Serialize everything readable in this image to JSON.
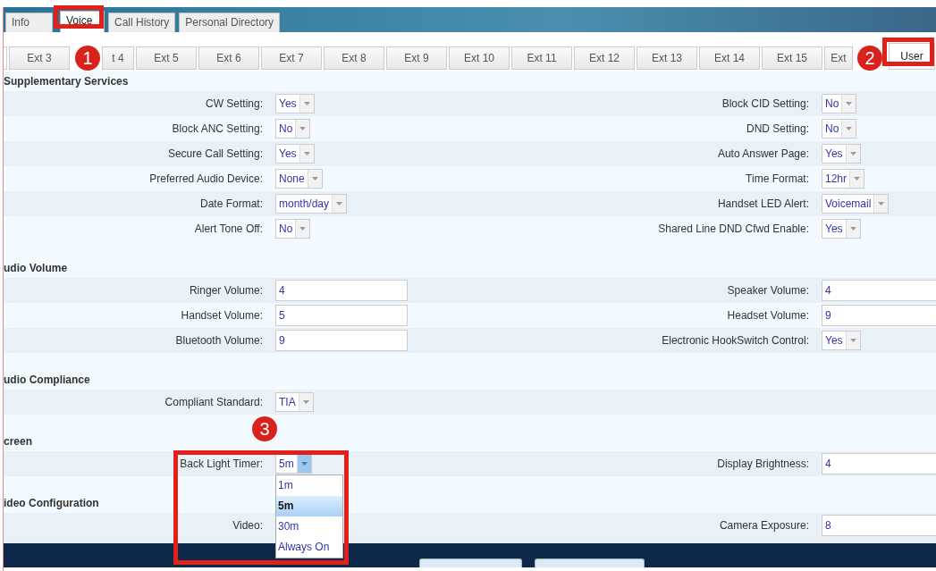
{
  "top_tabs": [
    {
      "label": "Info",
      "selected": false
    },
    {
      "label": "Voice",
      "selected": true
    },
    {
      "label": "Call History",
      "selected": false
    },
    {
      "label": "Personal Directory",
      "selected": false
    }
  ],
  "ext_tabs": [
    {
      "label": "Ext 3",
      "selected": false
    },
    {
      "label": "t 4",
      "selected": false
    },
    {
      "label": "Ext 5",
      "selected": false
    },
    {
      "label": "Ext 6",
      "selected": false
    },
    {
      "label": "Ext 7",
      "selected": false
    },
    {
      "label": "Ext 8",
      "selected": false
    },
    {
      "label": "Ext 9",
      "selected": false
    },
    {
      "label": "Ext 10",
      "selected": false
    },
    {
      "label": "Ext 11",
      "selected": false
    },
    {
      "label": "Ext 12",
      "selected": false
    },
    {
      "label": "Ext 13",
      "selected": false
    },
    {
      "label": "Ext 14",
      "selected": false
    },
    {
      "label": "Ext 15",
      "selected": false
    },
    {
      "label": "Ext",
      "selected": false
    },
    {
      "label": "User",
      "selected": true
    }
  ],
  "sections": [
    {
      "title": "Supplementary Services",
      "rows": [
        {
          "left": {
            "label": "CW Setting:",
            "kind": "select",
            "value": "Yes"
          },
          "right": {
            "label": "Block CID Setting:",
            "kind": "select",
            "value": "No"
          }
        },
        {
          "left": {
            "label": "Block ANC Setting:",
            "kind": "select",
            "value": "No"
          },
          "right": {
            "label": "DND Setting:",
            "kind": "select",
            "value": "No"
          }
        },
        {
          "left": {
            "label": "Secure Call Setting:",
            "kind": "select",
            "value": "Yes"
          },
          "right": {
            "label": "Auto Answer Page:",
            "kind": "select",
            "value": "Yes"
          }
        },
        {
          "left": {
            "label": "Preferred Audio Device:",
            "kind": "select",
            "value": "None"
          },
          "right": {
            "label": "Time Format:",
            "kind": "select",
            "value": "12hr"
          }
        },
        {
          "left": {
            "label": "Date Format:",
            "kind": "select",
            "value": "month/day"
          },
          "right": {
            "label": "Handset LED Alert:",
            "kind": "select",
            "value": "Voicemail"
          }
        },
        {
          "left": {
            "label": "Alert Tone Off:",
            "kind": "select",
            "value": "No"
          },
          "right": {
            "label": "Shared Line DND Cfwd Enable:",
            "kind": "select",
            "value": "Yes"
          }
        }
      ]
    },
    {
      "title": "udio Volume",
      "rows": [
        {
          "left": {
            "label": "Ringer Volume:",
            "kind": "input",
            "value": "4"
          },
          "right": {
            "label": "Speaker Volume:",
            "kind": "input",
            "value": "4"
          }
        },
        {
          "left": {
            "label": "Handset Volume:",
            "kind": "input",
            "value": "5"
          },
          "right": {
            "label": "Headset Volume:",
            "kind": "input",
            "value": "9"
          }
        },
        {
          "left": {
            "label": "Bluetooth Volume:",
            "kind": "input",
            "value": "9"
          },
          "right": {
            "label": "Electronic HookSwitch Control:",
            "kind": "select",
            "value": "Yes"
          }
        }
      ]
    },
    {
      "title": "udio Compliance",
      "rows": [
        {
          "left": {
            "label": "Compliant Standard:",
            "kind": "select",
            "value": "TIA"
          }
        }
      ]
    },
    {
      "title": "creen",
      "rows": [
        {
          "left": {
            "label": "Back Light Timer:",
            "kind": "select",
            "value": "5m",
            "expanded": true,
            "options": [
              {
                "label": "1m",
                "selected": false
              },
              {
                "label": "5m",
                "selected": true
              },
              {
                "label": "30m",
                "selected": false
              },
              {
                "label": "Always On",
                "selected": false
              }
            ]
          },
          "right": {
            "label": "Display Brightness:",
            "kind": "input",
            "value": "4"
          }
        }
      ]
    },
    {
      "title": "ideo Configuration",
      "rows": [
        {
          "left": {
            "label": "Video:",
            "kind": "hidden"
          },
          "right": {
            "label": "Camera Exposure:",
            "kind": "input",
            "value": "8"
          }
        }
      ]
    }
  ],
  "annotations": [
    {
      "number": "1"
    },
    {
      "number": "2"
    },
    {
      "number": "3"
    }
  ]
}
